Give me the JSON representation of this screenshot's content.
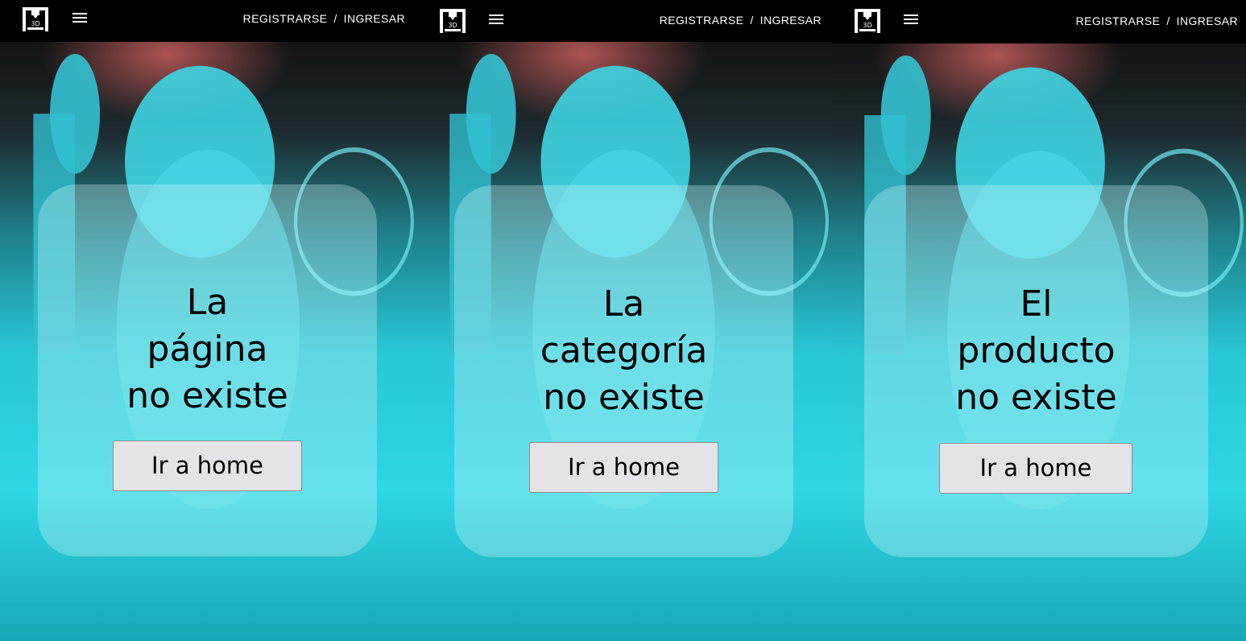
{
  "screens": [
    {
      "topbar": {
        "register": "REGISTRARSE",
        "separator": "/",
        "login": "INGRESAR"
      },
      "message": {
        "line1": "La",
        "line2": "página",
        "line3": "no existe"
      },
      "button": {
        "label": "Ir a home"
      }
    },
    {
      "topbar": {
        "register": "REGISTRARSE",
        "separator": "/",
        "login": "INGRESAR"
      },
      "message": {
        "line1": "La",
        "line2": "categoría",
        "line3": "no existe"
      },
      "button": {
        "label": "Ir a home"
      }
    },
    {
      "topbar": {
        "register": "REGISTRARSE",
        "separator": "/",
        "login": "INGRESAR"
      },
      "message": {
        "line1": "El",
        "line2": "producto",
        "line3": "no existe"
      },
      "button": {
        "label": "Ir a home"
      }
    }
  ],
  "logo": {
    "text": "3D"
  },
  "icons": {
    "logo": "3d-printer-logo-icon",
    "menu": "hamburger-menu-icon"
  },
  "colors": {
    "topbar": "#000000",
    "accent_cyan": "#2fd6e3",
    "button_bg": "#e4e3e8",
    "text": "#000000"
  }
}
